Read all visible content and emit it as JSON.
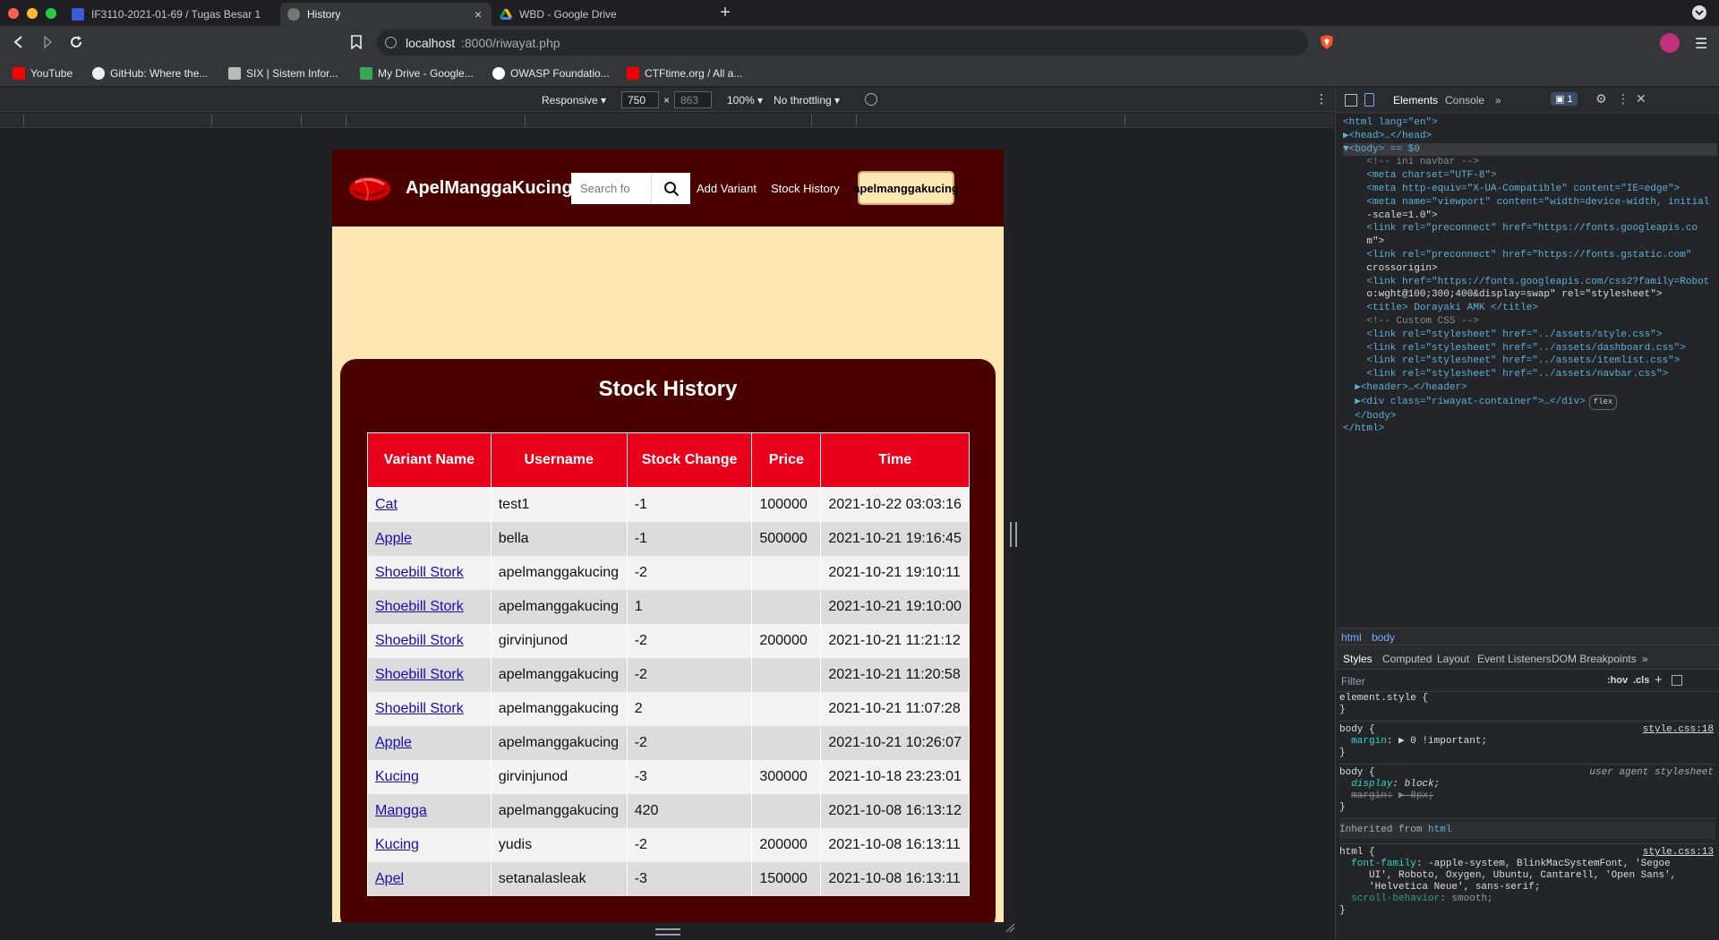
{
  "browser": {
    "tabs": [
      {
        "title": "IF3110-2021-01-69 / Tugas Besar 1"
      },
      {
        "title": "History"
      },
      {
        "title": "WBD - Google Drive"
      }
    ],
    "url_host": "localhost",
    "url_rest": ":8000/riwayat.php",
    "bookmarks": [
      "YouTube",
      "GitHub: Where the...",
      "SIX | Sistem Infor...",
      "My Drive - Google...",
      "OWASP Foundatio...",
      "CTFtime.org / All a..."
    ]
  },
  "device_toolbar": {
    "mode": "Responsive",
    "width": "750",
    "height": "863",
    "zoom": "100%",
    "throttling": "No throttling"
  },
  "site": {
    "brand": "ApelManggaKucing",
    "search_placeholder": "Search fo",
    "nav_add": "Add Variant",
    "nav_history": "Stock History",
    "user": "apelmanggakucing",
    "card_title": "Stock History",
    "columns": [
      "Variant Name",
      "Username",
      "Stock Change",
      "Price",
      "Time"
    ],
    "rows": [
      {
        "variant": "Cat",
        "user": "test1",
        "change": "-1",
        "price": "100000",
        "time": "2021-10-22 03:03:16"
      },
      {
        "variant": "Apple",
        "user": "bella",
        "change": "-1",
        "price": "500000",
        "time": "2021-10-21 19:16:45"
      },
      {
        "variant": "Shoebill Stork",
        "user": "apelmanggakucing",
        "change": "-2",
        "price": "",
        "time": "2021-10-21 19:10:11"
      },
      {
        "variant": "Shoebill Stork",
        "user": "apelmanggakucing",
        "change": "1",
        "price": "",
        "time": "2021-10-21 19:10:00"
      },
      {
        "variant": "Shoebill Stork",
        "user": "girvinjunod",
        "change": "-2",
        "price": "200000",
        "time": "2021-10-21 11:21:12"
      },
      {
        "variant": "Shoebill Stork",
        "user": "apelmanggakucing",
        "change": "-2",
        "price": "",
        "time": "2021-10-21 11:20:58"
      },
      {
        "variant": "Shoebill Stork",
        "user": "apelmanggakucing",
        "change": "2",
        "price": "",
        "time": "2021-10-21 11:07:28"
      },
      {
        "variant": "Apple",
        "user": "apelmanggakucing",
        "change": "-2",
        "price": "",
        "time": "2021-10-21 10:26:07"
      },
      {
        "variant": "Kucing",
        "user": "girvinjunod",
        "change": "-3",
        "price": "300000",
        "time": "2021-10-18 23:23:01"
      },
      {
        "variant": "Mangga",
        "user": "apelmanggakucing",
        "change": "420",
        "price": "",
        "time": "2021-10-08 16:13:12"
      },
      {
        "variant": "Kucing",
        "user": "yudis",
        "change": "-2",
        "price": "200000",
        "time": "2021-10-08 16:13:11"
      },
      {
        "variant": "Apel",
        "user": "setanalasleak",
        "change": "-3",
        "price": "150000",
        "time": "2021-10-08 16:13:11"
      }
    ]
  },
  "devtools": {
    "tabs": [
      "Elements",
      "Console"
    ],
    "issue_count": "1",
    "dom_lines": [
      "<html lang=\"en\">",
      "▶<head>…</head>",
      "▼<body> == $0",
      "    <!-- ini navbar -->",
      "    <meta charset=\"UTF-8\">",
      "    <meta http-equiv=\"X-UA-Compatible\" content=\"IE=edge\">",
      "    <meta name=\"viewport\" content=\"width=device-width, initial",
      "    -scale=1.0\">",
      "    <link rel=\"preconnect\" href=\"https://fonts.googleapis.co",
      "    m\">",
      "    <link rel=\"preconnect\" href=\"https://fonts.gstatic.com\"",
      "    crossorigin>",
      "    <link href=\"https://fonts.googleapis.com/css2?family=Robot",
      "    o:wght@100;300;400&display=swap\" rel=\"stylesheet\">",
      "    <title> Dorayaki AMK </title>",
      "    <!-- Custom CSS -->",
      "    <link rel=\"stylesheet\" href=\"../assets/style.css\">",
      "    <link rel=\"stylesheet\" href=\"../assets/dashboard.css\">",
      "    <link rel=\"stylesheet\" href=\"../assets/itemlist.css\">",
      "    <link rel=\"stylesheet\" href=\"../assets/navbar.css\">",
      "  ▶<header>…</header>",
      "  ▶<div class=\"riwayat-container\">…</div>",
      "  </body>",
      "</html>"
    ],
    "flex_badge": "flex",
    "breadcrumbs": [
      "html",
      "body"
    ],
    "style_tabs": [
      "Styles",
      "Computed",
      "Layout",
      "Event Listeners",
      "DOM Breakpoints"
    ],
    "filter_placeholder": "Filter",
    "hov": ":hov",
    "cls": ".cls",
    "styles": {
      "element_style": "element.style {",
      "close": "}",
      "body1_sel": "body {",
      "body1_src": "style.css:18",
      "body1_prop": "margin",
      "body1_val": ": ▶ 0 !important;",
      "body2_sel": "body {",
      "body2_src": "user agent stylesheet",
      "body2_prop1": "display",
      "body2_val1": ": block;",
      "body2_prop2": "margin:",
      "body2_val2": "▶ 8px;",
      "inherited": "Inherited from",
      "inherited_from": "html",
      "html_sel": "html {",
      "html_src": "style.css:13",
      "html_prop": "font-family",
      "html_val1": ": -apple-system, BlinkMacSystemFont, 'Segoe",
      "html_val2": "     UI', Roboto, Oxygen, Ubuntu, Cantarell, 'Open Sans',",
      "html_val3": "     'Helvetica Neue', sans-serif;",
      "html_prop2": "scroll-behavior",
      "html_val4": ": smooth;"
    }
  },
  "colors": {
    "site_nav": "#4b0000",
    "page_bg": "#fde7b3",
    "table_header": "#e8001a",
    "link": "#1a0dab"
  }
}
